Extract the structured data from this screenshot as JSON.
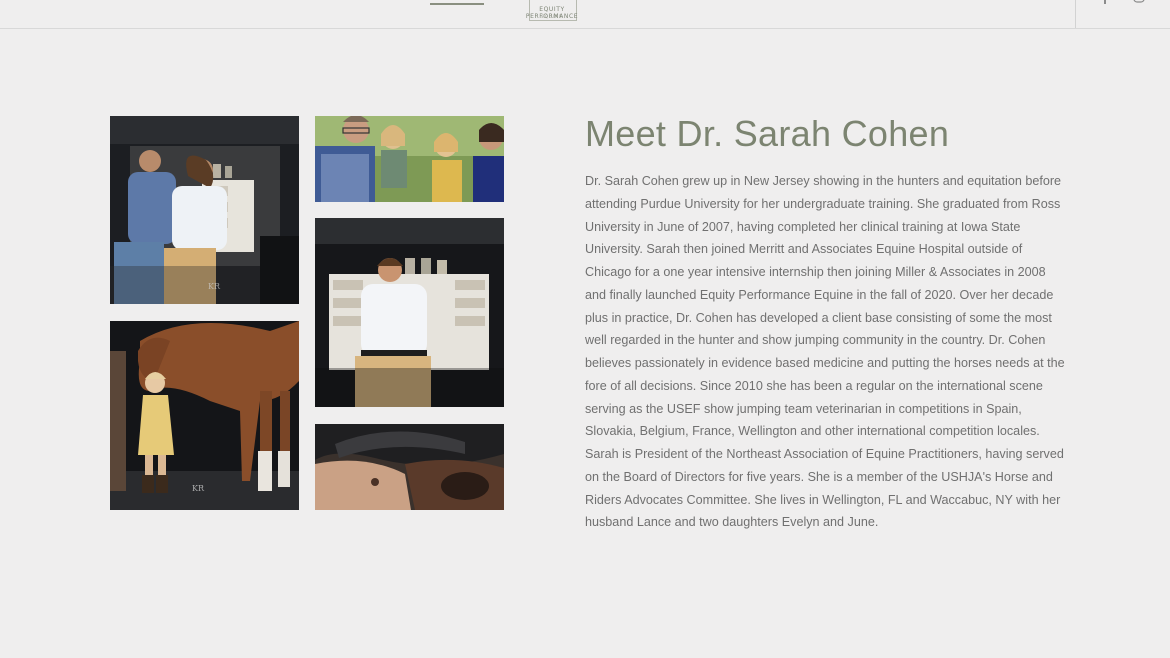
{
  "header": {
    "logo": {
      "line1": "EQUITY PERFORMANCE",
      "line2": "EQUINE"
    },
    "icons": [
      "facebook-icon",
      "instagram-icon"
    ]
  },
  "main": {
    "title": "Meet Dr. Sarah Cohen",
    "bio": "Dr. Sarah Cohen grew up in New Jersey showing in the hunters and equitation before attending Purdue University for her undergraduate training. She graduated from Ross University in June of 2007, having completed her clinical training at Iowa State University. Sarah then joined Merritt and Associates Equine Hospital outside of Chicago for a one year intensive internship then joining Miller & Associates in 2008 and finally launched Equity Performance Equine in the fall of 2020. Over her decade plus in practice, Dr. Cohen has developed a client base consisting of some the most well regarded in the hunter and show jumping community in the country. Dr. Cohen believes passionately in evidence based medicine and putting the horses needs at the fore of all decisions. Since 2010 she has been a regular on the international scene serving as the USEF show jumping team veterinarian in competitions in Spain, Slovakia, Belgium, France, Wellington and other international competition locales. Sarah is President of the Northeast Association of Equine Practitioners, having served on the Board of Directors for five years. She is a member of the USHJA's Horse and Riders Advocates Committee. She lives in Wellington, FL and Waccabuc, NY with her husband Lance and two daughters Evelyn and June."
  },
  "gallery": {
    "watermark": "KR"
  }
}
